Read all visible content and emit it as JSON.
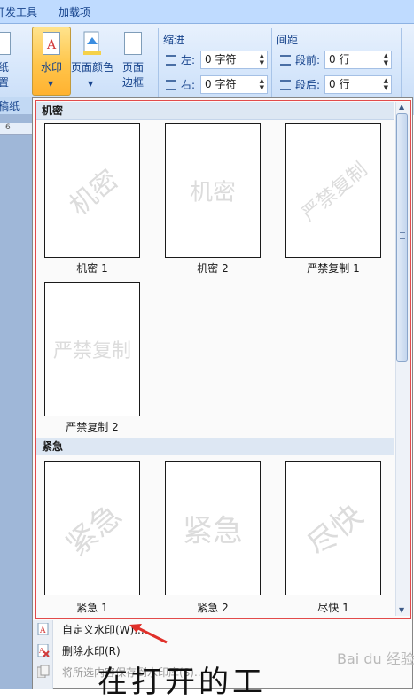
{
  "tabs": {
    "developer": "开发工具",
    "addins": "加载项"
  },
  "ribbon": {
    "page_bg_partial": {
      "line1": "纸",
      "line2": "置"
    },
    "group_label_partial": "稿纸",
    "watermark_button": "水印",
    "page_color_button": "页面颜色",
    "page_border_button": {
      "line1": "页面",
      "line2": "边框"
    },
    "indent": {
      "label": "缩进",
      "left_label": "左:",
      "left_value": "0 字符",
      "right_label": "右:",
      "right_value": "0 字符"
    },
    "spacing": {
      "label": "间距",
      "before_label": "段前:",
      "before_value": "0 行",
      "after_label": "段后:",
      "after_value": "0 行"
    }
  },
  "ruler": {
    "tick": "6"
  },
  "gallery": {
    "categories": [
      {
        "name": "机密"
      },
      {
        "name": "紧急"
      }
    ],
    "items_confidential": [
      {
        "label": "机密 1",
        "text": "机密"
      },
      {
        "label": "机密 2",
        "text": "机密"
      },
      {
        "label": "严禁复制 1",
        "text": "严禁复制"
      },
      {
        "label": "严禁复制 2",
        "text": "严禁复制"
      }
    ],
    "items_urgent": [
      {
        "label": "紧急 1",
        "text": "紧急"
      },
      {
        "label": "紧急 2",
        "text": "紧急"
      },
      {
        "label": "尽快 1",
        "text": "尽快"
      }
    ]
  },
  "menu": {
    "custom_watermark": "自定义水印(W)...",
    "remove_watermark": "删除水印(R)",
    "save_to_gallery": "将所选内容保存到水印库(S)..."
  },
  "site_watermark": "Bai du 经验",
  "bottom_partial_text": "在打开的工"
}
